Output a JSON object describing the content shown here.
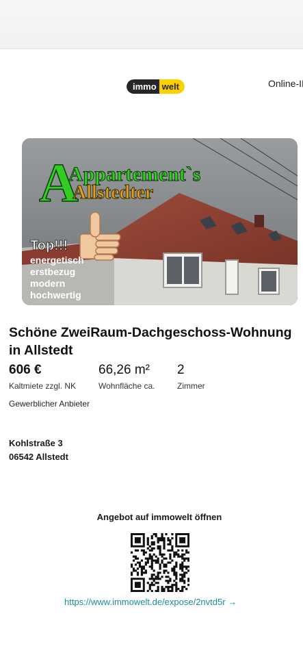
{
  "logo": {
    "part1": "immo",
    "part2": "welt"
  },
  "header": {
    "online_id": "Online-ID"
  },
  "hero": {
    "headline_1": "Appartement`s",
    "headline_2": "Allstedter",
    "badge": "Top!!!",
    "features": [
      "energetisch",
      "erstbezug",
      "modern",
      "hochwertig"
    ]
  },
  "listing": {
    "title": "Schöne ZweiRaum-Dachgeschoss-Wohnung in Allstedt",
    "price": {
      "value": "606 €",
      "label": "Kaltmiete zzgl. NK"
    },
    "area": {
      "value": "66,26 m²",
      "label": "Wohnfläche ca."
    },
    "rooms": {
      "value": "2",
      "label": "Zimmer"
    },
    "provider": "Gewerblicher Anbieter",
    "address": {
      "street": "Kohlstraße 3",
      "city": "06542 Allstedt"
    }
  },
  "cta": {
    "label": "Angebot auf immowelt öffnen",
    "url": "https://www.immowelt.de/expose/2nvtd5r →"
  },
  "colors": {
    "brand_yellow": "#ffd000",
    "brand_dark": "#262626",
    "link": "#1a8c99",
    "headline_green": "#33cc22"
  }
}
